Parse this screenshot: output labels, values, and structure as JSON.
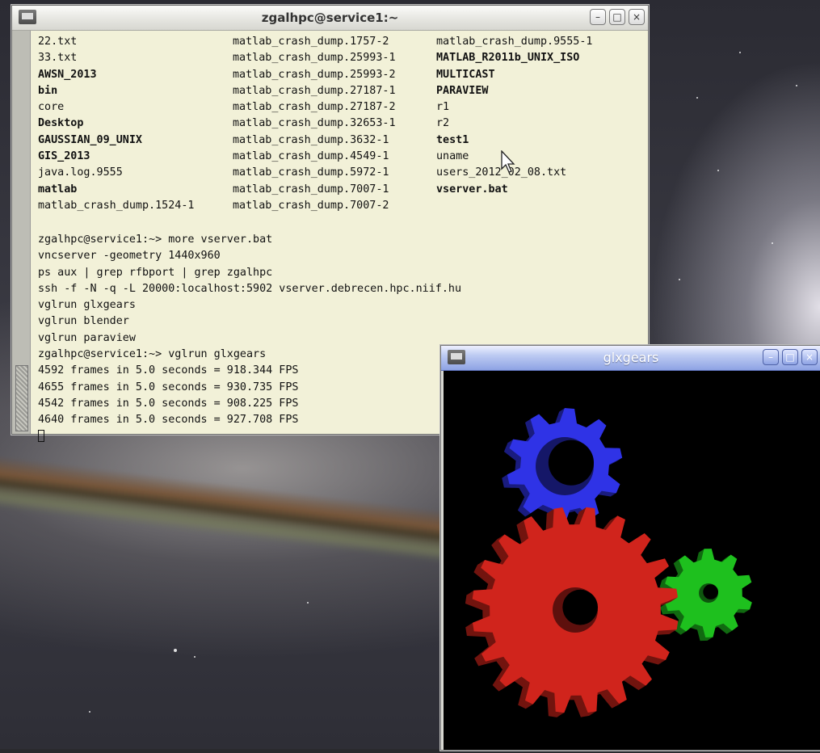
{
  "terminal": {
    "title": "zgalhpc@service1:~",
    "window_buttons": {
      "minimize": "–",
      "maximize": "□",
      "close": "×"
    },
    "ls_columns": [
      [
        {
          "text": "22.txt",
          "kind": "file"
        },
        {
          "text": "33.txt",
          "kind": "file"
        },
        {
          "text": "AWSN_2013",
          "kind": "dir"
        },
        {
          "text": "bin",
          "kind": "dir"
        },
        {
          "text": "core",
          "kind": "file"
        },
        {
          "text": "Desktop",
          "kind": "dir"
        },
        {
          "text": "GAUSSIAN_09_UNIX",
          "kind": "dir"
        },
        {
          "text": "GIS_2013",
          "kind": "dir"
        },
        {
          "text": "java.log.9555",
          "kind": "file"
        },
        {
          "text": "matlab",
          "kind": "dir"
        },
        {
          "text": "matlab_crash_dump.1524-1",
          "kind": "file"
        }
      ],
      [
        {
          "text": "matlab_crash_dump.1757-2",
          "kind": "file"
        },
        {
          "text": "matlab_crash_dump.25993-1",
          "kind": "file"
        },
        {
          "text": "matlab_crash_dump.25993-2",
          "kind": "file"
        },
        {
          "text": "matlab_crash_dump.27187-1",
          "kind": "file"
        },
        {
          "text": "matlab_crash_dump.27187-2",
          "kind": "file"
        },
        {
          "text": "matlab_crash_dump.32653-1",
          "kind": "file"
        },
        {
          "text": "matlab_crash_dump.3632-1",
          "kind": "file"
        },
        {
          "text": "matlab_crash_dump.4549-1",
          "kind": "file"
        },
        {
          "text": "matlab_crash_dump.5972-1",
          "kind": "file"
        },
        {
          "text": "matlab_crash_dump.7007-1",
          "kind": "file"
        },
        {
          "text": "matlab_crash_dump.7007-2",
          "kind": "file"
        }
      ],
      [
        {
          "text": "matlab_crash_dump.9555-1",
          "kind": "file"
        },
        {
          "text": "MATLAB_R2011b_UNIX_ISO",
          "kind": "dir"
        },
        {
          "text": "MULTICAST",
          "kind": "dir"
        },
        {
          "text": "PARAVIEW",
          "kind": "dir"
        },
        {
          "text": "r1",
          "kind": "file"
        },
        {
          "text": "r2",
          "kind": "file"
        },
        {
          "text": "test1",
          "kind": "dir"
        },
        {
          "text": "uname",
          "kind": "file"
        },
        {
          "text": "users_2012_02_08.txt",
          "kind": "file"
        },
        {
          "text": "vserver.bat",
          "kind": "exe"
        }
      ]
    ],
    "lines": [
      "zgalhpc@service1:~> more vserver.bat",
      "vncserver -geometry 1440x960",
      "ps aux | grep rfbport | grep zgalhpc",
      "ssh -f -N -q -L 20000:localhost:5902 vserver.debrecen.hpc.niif.hu",
      "vglrun glxgears",
      "vglrun blender",
      "vglrun paraview",
      "zgalhpc@service1:~> vglrun glxgears",
      "4592 frames in 5.0 seconds = 918.344 FPS",
      "4655 frames in 5.0 seconds = 930.735 FPS",
      "4542 frames in 5.0 seconds = 908.225 FPS",
      "4640 frames in 5.0 seconds = 927.708 FPS"
    ]
  },
  "glxgears": {
    "title": "glxgears",
    "window_buttons": {
      "minimize": "–",
      "maximize": "□",
      "close": "×"
    },
    "gear_colors": {
      "red": "#d0241c",
      "green": "#1ec01e",
      "blue": "#2f33e6"
    }
  },
  "colors": {
    "terminal_bg": "#f2f1d8",
    "dir": "#1a27c8",
    "exe": "#22c022"
  }
}
